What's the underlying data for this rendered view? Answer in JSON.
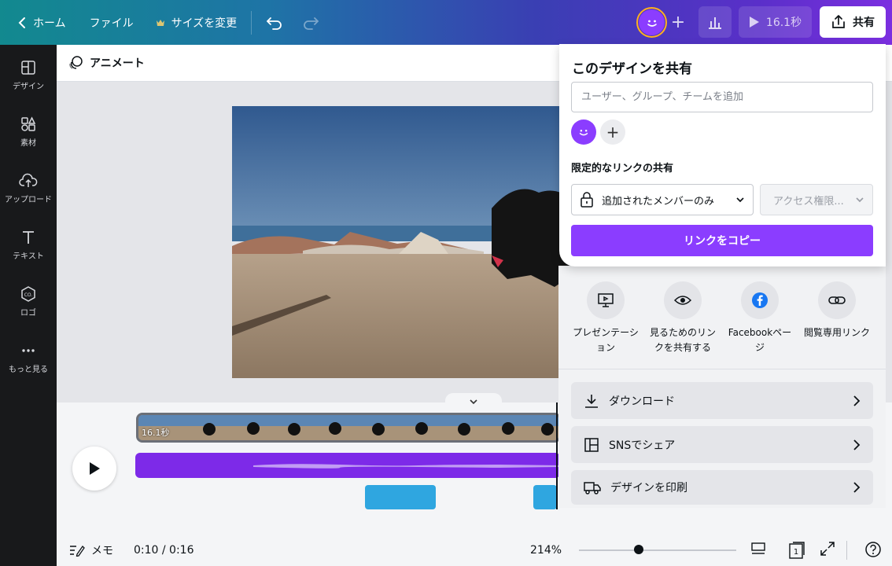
{
  "topbar": {
    "home_label": "ホーム",
    "file_label": "ファイル",
    "resize_label": "サイズを変更",
    "play_label": "16.1秒",
    "share_label": "共有"
  },
  "sidebar": {
    "items": [
      {
        "label": "デザイン",
        "icon": "design-icon"
      },
      {
        "label": "素材",
        "icon": "elements-icon"
      },
      {
        "label": "アップロード",
        "icon": "upload-icon"
      },
      {
        "label": "テキスト",
        "icon": "text-icon"
      },
      {
        "label": "ロゴ",
        "icon": "logo-icon"
      },
      {
        "label": "もっと見る",
        "icon": "more-icon"
      }
    ]
  },
  "subbar": {
    "animate_label": "アニメート"
  },
  "timeline": {
    "clip_duration": "16.1秒",
    "memo_label": "メモ",
    "time": "0:10 / 0:16",
    "zoom": "214%",
    "page_count": "1",
    "zoom_level": 0.38
  },
  "share": {
    "title": "このデザインを共有",
    "input_placeholder": "ユーザー、グループ、チームを追加",
    "section_label": "限定的なリンクの共有",
    "access_select": "追加されたメンバーのみ",
    "permission_select": "アクセス権限...",
    "copy_button": "リンクをコピー",
    "options": [
      {
        "label": "プレゼンテーション",
        "icon": "presentation-icon"
      },
      {
        "label": "見るためのリンクを共有する",
        "icon": "eye-icon"
      },
      {
        "label": "Facebookページ",
        "icon": "facebook-icon"
      },
      {
        "label": "閲覧専用リンク",
        "icon": "link-icon"
      }
    ],
    "rows": [
      {
        "label": "ダウンロード",
        "icon": "download-icon"
      },
      {
        "label": "SNSでシェア",
        "icon": "social-icon"
      },
      {
        "label": "デザインを印刷",
        "icon": "truck-icon"
      }
    ]
  },
  "colors": {
    "accent": "#8b3dff",
    "avatar_ring": "#ffb020",
    "sidebar": "#18191b"
  }
}
